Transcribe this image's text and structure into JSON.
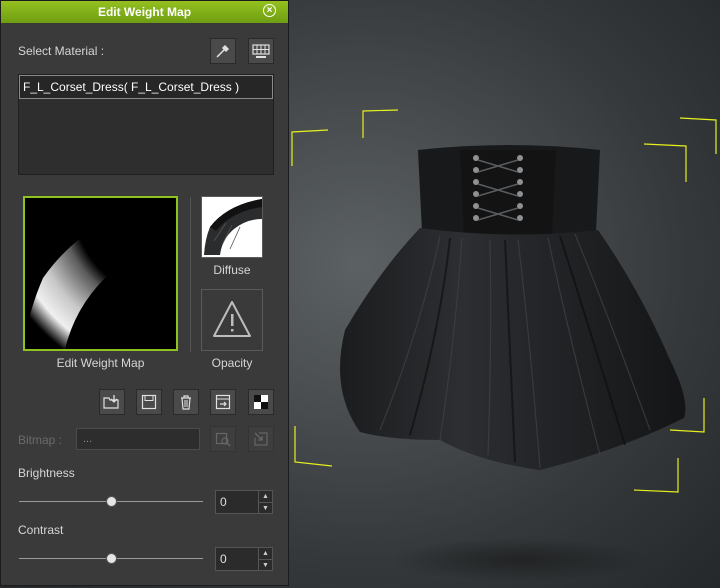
{
  "panel": {
    "title": "Edit Weight Map",
    "select_material_label": "Select Material :",
    "materials": [
      "F_L_Corset_Dress( F_L_Corset_Dress )"
    ],
    "weight_map_caption": "Edit Weight Map",
    "diffuse_caption": "Diffuse",
    "opacity_caption": "Opacity",
    "bitmap_label": "Bitmap :",
    "bitmap_value": "...",
    "brightness_label": "Brightness",
    "brightness_value": "0",
    "contrast_label": "Contrast",
    "contrast_value": "0"
  },
  "colors": {
    "accent": "#8dc21f",
    "panel_bg": "#3a3a3a",
    "bracket": "#e6f01e"
  }
}
